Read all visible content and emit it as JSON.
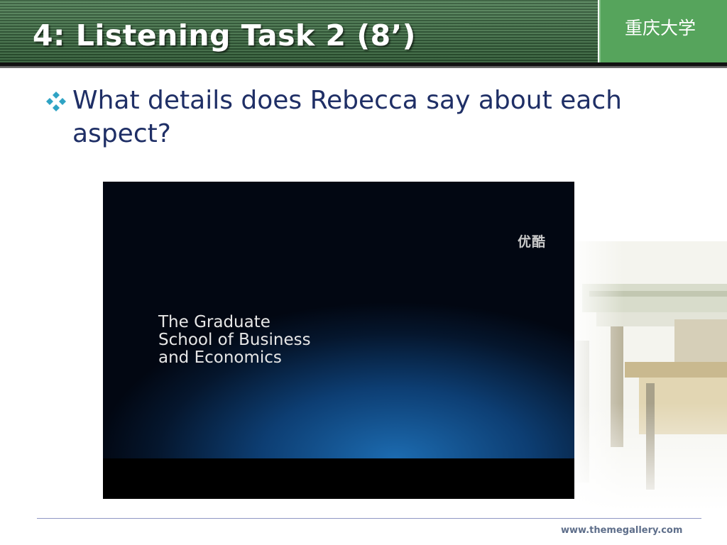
{
  "header": {
    "title": "4: Listening Task 2 (8’)",
    "organization": "重庆大学"
  },
  "content": {
    "bullet_icon": "diamond-bullet-icon",
    "bullet_text": "What details does Rebecca say about each aspect?"
  },
  "video": {
    "watermark": "优酷",
    "caption_lines": [
      "The Graduate",
      "School of Business",
      "and Economics"
    ]
  },
  "footer": {
    "url": "www.themegallery.com"
  },
  "colors": {
    "header_green": "#2f5a35",
    "org_green": "#56a45c",
    "text_navy": "#1f2f66",
    "bullet_teal": "#2fa3c4"
  }
}
